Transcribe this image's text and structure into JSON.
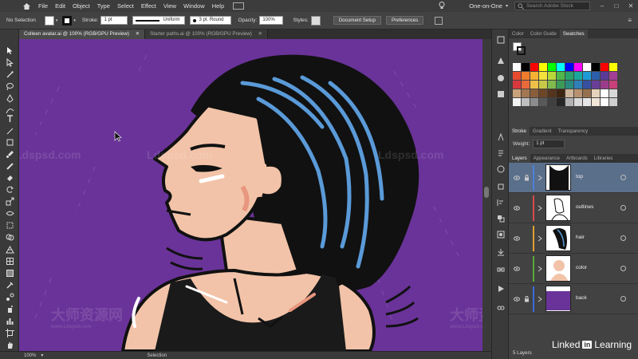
{
  "menubar": {
    "items": [
      "File",
      "Edit",
      "Object",
      "Type",
      "Select",
      "Effect",
      "View",
      "Window",
      "Help"
    ],
    "workspace": "One-on-One",
    "search_placeholder": "Search Adobe Stock"
  },
  "controlbar": {
    "selection_label": "No Selection",
    "stroke_label": "Stroke:",
    "stroke_weight": "1 pt",
    "profile": "Uniform",
    "brush": "3 pt. Round",
    "opacity_label": "Opacity:",
    "opacity_value": "100%",
    "styles_label": "Styles:",
    "doc_setup_label": "Document Setup",
    "preferences_label": "Preferences"
  },
  "tabs": [
    {
      "label": "Colleen avatar.ai @ 100% (RGB/GPU Preview)"
    },
    {
      "label": "Starter paths.ai @ 100% (RGB/GPU Preview)"
    }
  ],
  "statusbar": {
    "zoom": "100%",
    "tool": "Selection"
  },
  "panels": {
    "color_tabs": [
      "Color",
      "Color Guide",
      "Swatches"
    ],
    "stroke_tabs": [
      "Stroke",
      "Gradient",
      "Transparency"
    ],
    "weight_label": "Weight:",
    "weight_value": "1 pt",
    "layers_tabs": [
      "Layers",
      "Appearance",
      "Artboards",
      "Libraries"
    ],
    "layers": [
      {
        "name": "top",
        "color": "#4e80d8"
      },
      {
        "name": "outlines",
        "color": "#d84a4a"
      },
      {
        "name": "hair",
        "color": "#e0a030"
      },
      {
        "name": "color",
        "color": "#5aa83a"
      },
      {
        "name": "back",
        "color": "#3a6adf"
      }
    ],
    "layer_count": "5 Layers"
  },
  "swatches": {
    "row1": [
      "#ffffff",
      "#000000",
      "#ff0000",
      "#ffff00",
      "#00ff00",
      "#00ffff",
      "#0000ff",
      "#ff00ff",
      "#ffffff",
      "#000000",
      "#ff0000",
      "#ffff00"
    ],
    "row2": [
      "#e84a2f",
      "#f07c2c",
      "#f6b233",
      "#f4e13c",
      "#b8d83a",
      "#4fb64a",
      "#29a26b",
      "#19a79d",
      "#1d9bd6",
      "#2c5fab",
      "#5a3a96",
      "#a33e95"
    ],
    "row3": [
      "#d9383d",
      "#e86a3a",
      "#edc04a",
      "#c8c848",
      "#7fba4b",
      "#3c9a58",
      "#2b8a7f",
      "#2f7fb8",
      "#3750a0",
      "#6a3e98",
      "#9a3b8c",
      "#c8407a"
    ],
    "row4": [
      "#c9a27a",
      "#a37751",
      "#8a5e3a",
      "#6e4628",
      "#54341c",
      "#3e2612",
      "#cfb59a",
      "#b89270",
      "#96714e",
      "#e6d2bc",
      "#ffffff",
      "#d8d8d8"
    ],
    "row5": [
      "#f2f2f2",
      "#bfbfbf",
      "#8c8c8c",
      "#595959",
      "#404040",
      "#262626",
      "#b3b3b3",
      "#d9d9d9",
      "#e6e6e6",
      "#f2e6d9",
      "#ffffff",
      "#cfcfcf"
    ]
  },
  "watermarks": [
    "Ldspsd.com",
    "Ldspsd.com",
    "Ldspsd.com",
    "大师资源网",
    "大师资源网",
    "www.Ldspsd.com",
    "www.Ldspsd.com"
  ],
  "brand": {
    "name": "Linked",
    "in": "in",
    "suffix": "Learning"
  }
}
